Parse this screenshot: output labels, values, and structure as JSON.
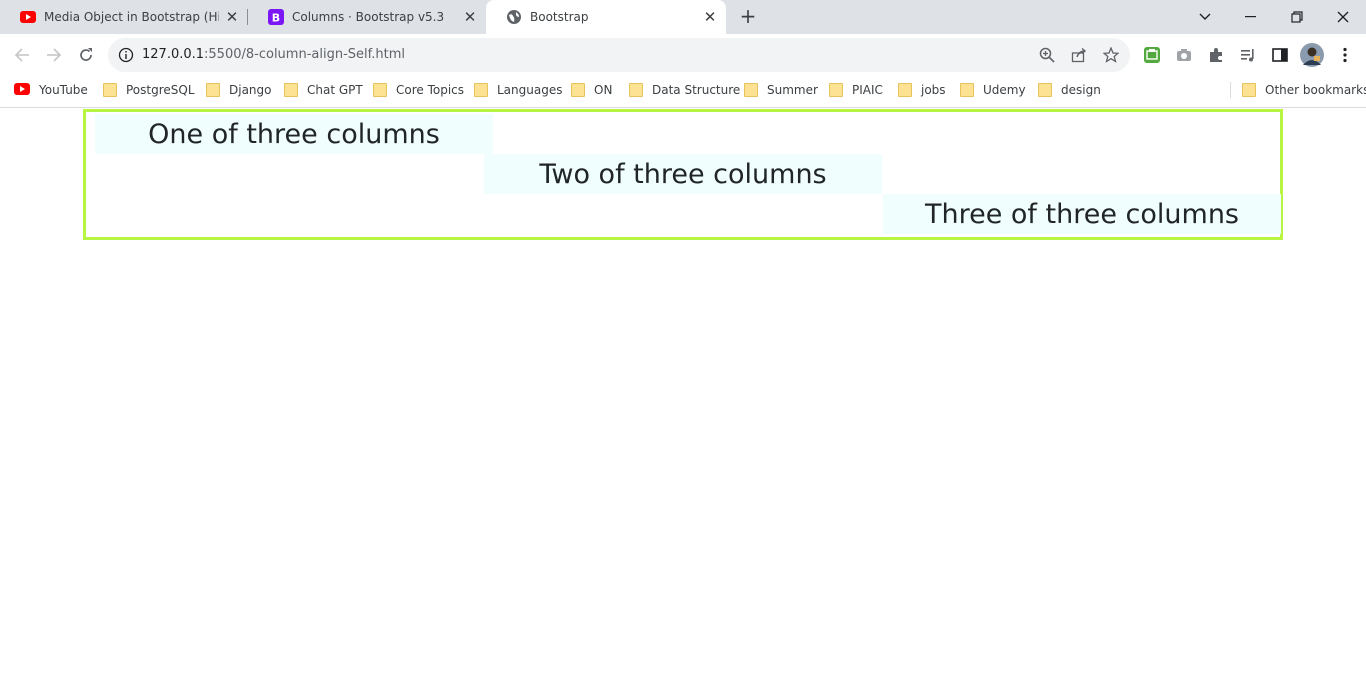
{
  "browser": {
    "tabs": [
      {
        "title": "Media Object in Bootstrap (Hindi",
        "icon": "youtube-icon",
        "active": false
      },
      {
        "title": "Columns · Bootstrap v5.3",
        "icon": "bootstrap-icon",
        "active": false
      },
      {
        "title": "Bootstrap",
        "icon": "globe-icon",
        "active": true
      }
    ],
    "url_host": "127.0.0.1",
    "url_rest": ":5500/8-column-align-Self.html"
  },
  "bookmarks": [
    {
      "label": "YouTube",
      "icon": "youtube-icon"
    },
    {
      "label": "PostgreSQL",
      "icon": "folder-icon"
    },
    {
      "label": "Django",
      "icon": "folder-icon"
    },
    {
      "label": "Chat GPT",
      "icon": "folder-icon"
    },
    {
      "label": "Core Topics",
      "icon": "folder-icon"
    },
    {
      "label": "Languages",
      "icon": "folder-icon"
    },
    {
      "label": "ON",
      "icon": "folder-icon"
    },
    {
      "label": "Data Structure",
      "icon": "folder-icon"
    },
    {
      "label": "Summer",
      "icon": "folder-icon"
    },
    {
      "label": "PIAIC",
      "icon": "folder-icon"
    },
    {
      "label": "jobs",
      "icon": "folder-icon"
    },
    {
      "label": "Udemy",
      "icon": "folder-icon"
    },
    {
      "label": "design",
      "icon": "folder-icon"
    }
  ],
  "other_bookmarks": "Other bookmarks",
  "page": {
    "columns": [
      "One of three columns",
      "Two of three columns",
      "Three of three columns"
    ],
    "border_color": "#b8f542",
    "column_bg": "#f0fffe"
  }
}
